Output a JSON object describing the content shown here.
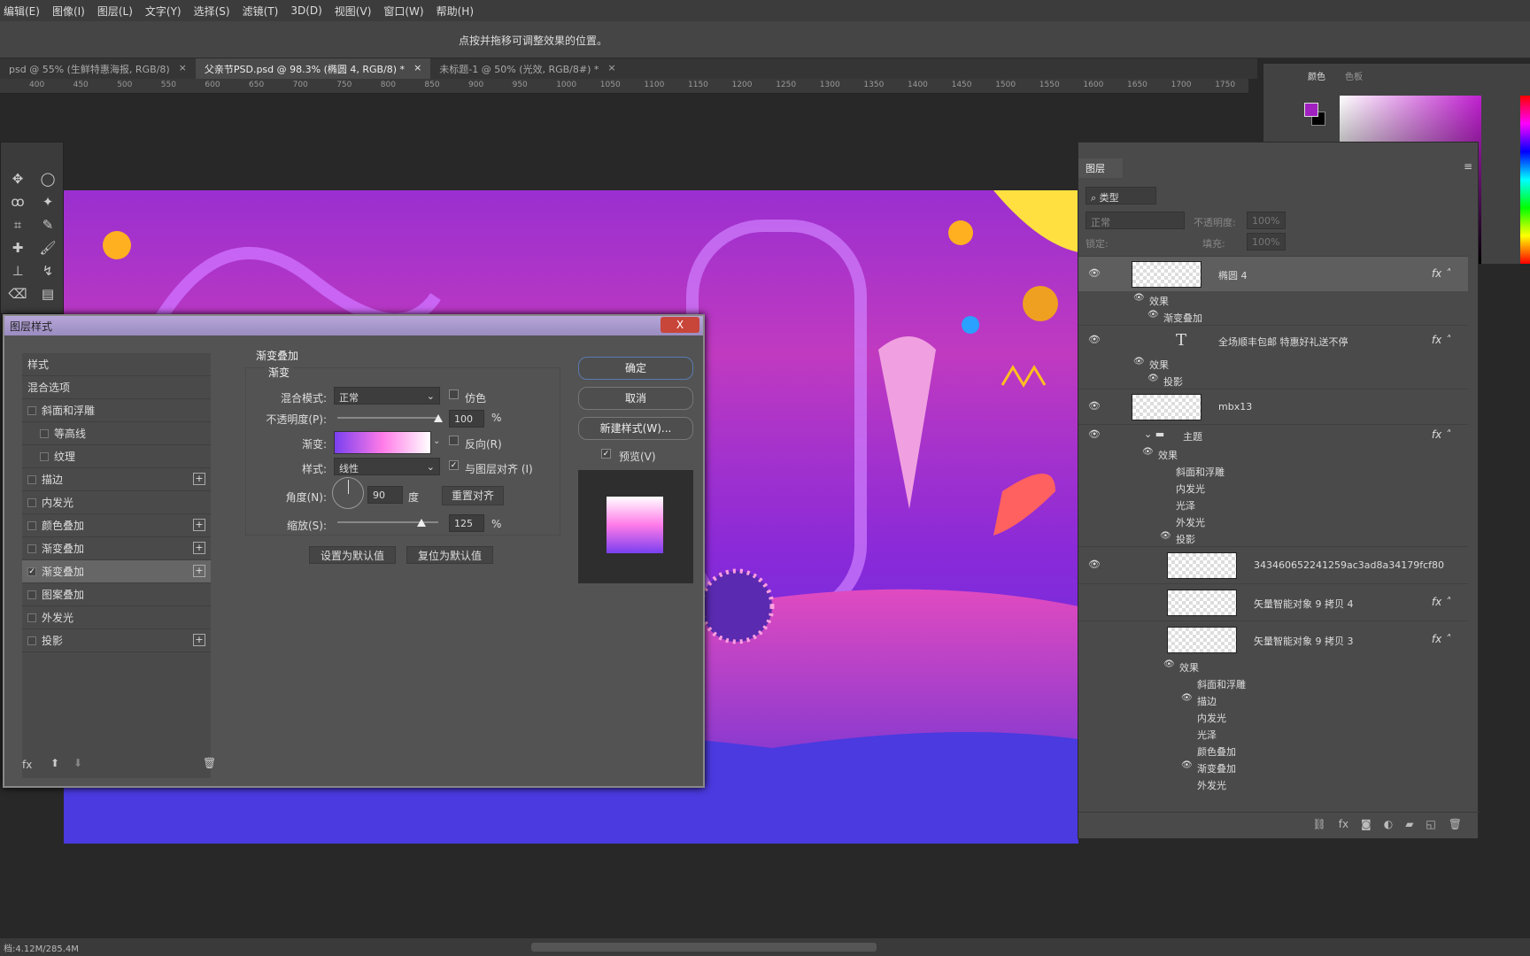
{
  "menu": [
    "编辑(E)",
    "图像(I)",
    "图层(L)",
    "文字(Y)",
    "选择(S)",
    "滤镜(T)",
    "3D(D)",
    "视图(V)",
    "窗口(W)",
    "帮助(H)"
  ],
  "options_hint": "点按并拖移可调整效果的位置。",
  "tabs": [
    {
      "label": "psd @ 55% (生鲜特惠海报, RGB/8)",
      "active": false
    },
    {
      "label": "父亲节PSD.psd @ 98.3% (椭圆 4, RGB/8) *",
      "active": true
    },
    {
      "label": "未标题-1 @ 50% (光效, RGB/8#) *",
      "active": false
    }
  ],
  "ruler": [
    "400",
    "450",
    "500",
    "550",
    "600",
    "650",
    "700",
    "750",
    "800",
    "850",
    "900",
    "950",
    "1000",
    "1050",
    "1100",
    "1150",
    "1200",
    "1250",
    "1300",
    "1350",
    "1400",
    "1450",
    "1500",
    "1550",
    "1600",
    "1650",
    "1700",
    "1750"
  ],
  "dialog": {
    "title": "图层样式",
    "close": "X",
    "styles": [
      {
        "label": "样式",
        "cb": null
      },
      {
        "label": "混合选项",
        "cb": null
      },
      {
        "label": "斜面和浮雕",
        "cb": false
      },
      {
        "label": "等高线",
        "cb": false,
        "indent": true
      },
      {
        "label": "纹理",
        "cb": false,
        "indent": true
      },
      {
        "label": "描边",
        "cb": false,
        "plus": true
      },
      {
        "label": "内发光",
        "cb": false
      },
      {
        "label": "颜色叠加",
        "cb": false,
        "plus": true
      },
      {
        "label": "渐变叠加",
        "cb": false,
        "plus": true
      },
      {
        "label": "渐变叠加",
        "cb": true,
        "plus": true,
        "selected": true
      },
      {
        "label": "图案叠加",
        "cb": false
      },
      {
        "label": "外发光",
        "cb": false
      },
      {
        "label": "投影",
        "cb": false,
        "plus": true
      }
    ],
    "section": "渐变叠加",
    "group": "渐变",
    "blend_label": "混合模式:",
    "blend_value": "正常",
    "dither_label": "仿色",
    "opacity_label": "不透明度(P):",
    "opacity_value": "100",
    "opacity_unit": "%",
    "opacity": 100,
    "gradient_label": "渐变:",
    "reverse_label": "反向(R)",
    "style_label": "样式:",
    "style_value": "线性",
    "align_label": "与图层对齐 (I)",
    "angle_label": "角度(N):",
    "angle_value": "90",
    "angle_unit": "度",
    "reset_align": "重置对齐",
    "scale_label": "缩放(S):",
    "scale_value": "125",
    "scale_unit": "%",
    "scale": 125,
    "make_default": "设置为默认值",
    "reset_default": "复位为默认值",
    "ok": "确定",
    "cancel": "取消",
    "new_style": "新建样式(W)...",
    "preview_label": "预览(V)",
    "gradient_colors": [
      "#7a3ff0",
      "#ff7be8",
      "#ffffff"
    ]
  },
  "layers": {
    "title": "图层",
    "filter_placeholder": "类型",
    "blend": "正常",
    "opacity_label": "不透明度:",
    "opacity_value": "100%",
    "lock_label": "锁定:",
    "fill_label": "填充:",
    "fill_value": "100%",
    "rows": [
      {
        "type": "layer",
        "name": "椭圆 4",
        "fx": true,
        "eye": true,
        "selected": true
      },
      {
        "type": "effect",
        "name": "效果",
        "level": 1,
        "eye": true
      },
      {
        "type": "effect",
        "name": "渐变叠加",
        "level": 2,
        "eye": true
      },
      {
        "type": "text",
        "name": "全场顺丰包邮 特惠好礼送不停",
        "fx": true,
        "eye": true
      },
      {
        "type": "effect",
        "name": "效果",
        "level": 1,
        "eye": true
      },
      {
        "type": "effect",
        "name": "投影",
        "level": 2,
        "eye": true
      },
      {
        "type": "layer",
        "name": "mbx13",
        "eye": true
      },
      {
        "type": "group",
        "name": "主题",
        "fx": true,
        "eye": true
      },
      {
        "type": "effect",
        "name": "效果",
        "level": 3,
        "eye": true
      },
      {
        "type": "effect",
        "name": "斜面和浮雕",
        "level": 4
      },
      {
        "type": "effect",
        "name": "内发光",
        "level": 4
      },
      {
        "type": "effect",
        "name": "光泽",
        "level": 4
      },
      {
        "type": "effect",
        "name": "外发光",
        "level": 4
      },
      {
        "type": "effect",
        "name": "投影",
        "level": 4,
        "eye": true
      },
      {
        "type": "smart",
        "name": "343460652241259ac3ad8a34179fcf80",
        "eye": true
      },
      {
        "type": "smart",
        "name": "矢量智能对象 9 拷贝 4",
        "fx": true
      },
      {
        "type": "smart",
        "name": "矢量智能对象 9 拷贝 3",
        "fx": true
      },
      {
        "type": "effect",
        "name": "效果",
        "level": 5,
        "eye": true
      },
      {
        "type": "effect",
        "name": "斜面和浮雕",
        "level": 6
      },
      {
        "type": "effect",
        "name": "描边",
        "level": 6,
        "eye": true
      },
      {
        "type": "effect",
        "name": "内发光",
        "level": 6
      },
      {
        "type": "effect",
        "name": "光泽",
        "level": 6
      },
      {
        "type": "effect",
        "name": "颜色叠加",
        "level": 6
      },
      {
        "type": "effect",
        "name": "渐变叠加",
        "level": 6,
        "eye": true
      },
      {
        "type": "effect",
        "name": "外发光",
        "level": 6
      }
    ]
  },
  "color_panel": {
    "tabs": [
      "颜色",
      "色板"
    ],
    "foreground": "#a020c0",
    "background": "#000000"
  },
  "status": "档:4.12M/285.4M"
}
